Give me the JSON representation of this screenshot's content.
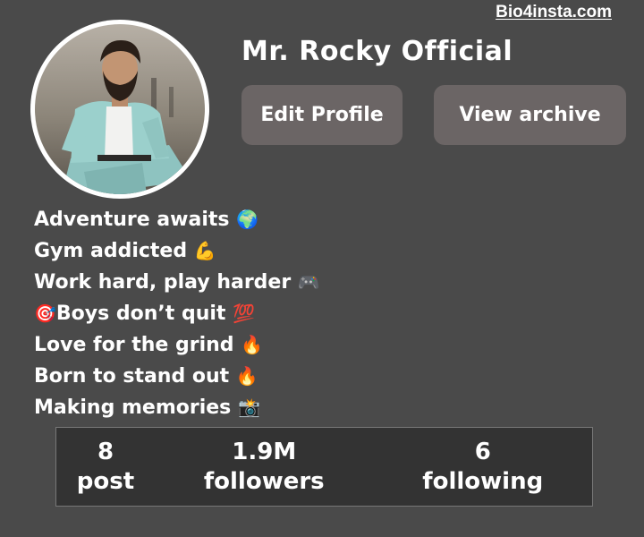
{
  "watermark": "Bio4insta.com",
  "profile": {
    "name": "Mr. Rocky Official",
    "avatar_icon": "profile-photo"
  },
  "actions": {
    "edit_label": "Edit Profile",
    "archive_label": "View archive"
  },
  "bio": [
    {
      "prefix": "",
      "text": "Adventure awaits ",
      "emoji": "🌍"
    },
    {
      "prefix": "",
      "text": "Gym addicted ",
      "emoji": "💪"
    },
    {
      "prefix": "",
      "text": "Work hard, play harder ",
      "emoji": "🎮"
    },
    {
      "prefix": "🎯",
      "text": "Boys don’t quit ",
      "emoji": "💯"
    },
    {
      "prefix": "",
      "text": "Love for the grind ",
      "emoji": "🔥"
    },
    {
      "prefix": "",
      "text": "Born to stand out ",
      "emoji": "🔥"
    },
    {
      "prefix": "",
      "text": "Making memories ",
      "emoji": "📸"
    }
  ],
  "stats": [
    {
      "value": "8",
      "label": "post"
    },
    {
      "value": "1.9M",
      "label": "followers"
    },
    {
      "value": "6",
      "label": "following"
    }
  ],
  "colors": {
    "background": "#4a4a4a",
    "button": "#6b6565",
    "stats_panel": "#333333",
    "text": "#ffffff"
  }
}
